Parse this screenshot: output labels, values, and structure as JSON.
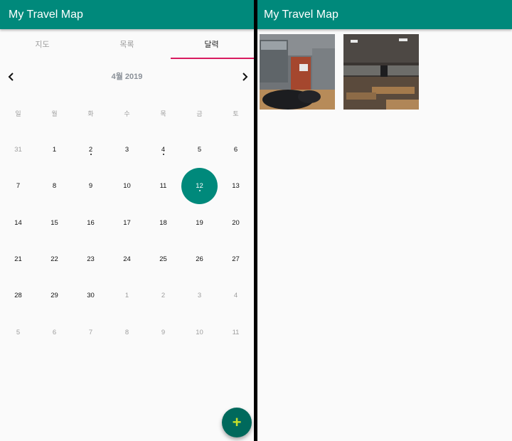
{
  "left_screen": {
    "app_title": "My Travel Map",
    "tabs": [
      {
        "label": "지도",
        "active": false
      },
      {
        "label": "목록",
        "active": false
      },
      {
        "label": "달력",
        "active": true
      }
    ],
    "calendar": {
      "month_label": "4월 2019",
      "weekdays": [
        "일",
        "월",
        "화",
        "수",
        "목",
        "금",
        "토"
      ],
      "selected_day": "12",
      "days": [
        {
          "d": "31",
          "m": true,
          "dot": false
        },
        {
          "d": "1",
          "m": false,
          "dot": false
        },
        {
          "d": "2",
          "m": false,
          "dot": true
        },
        {
          "d": "3",
          "m": false,
          "dot": false
        },
        {
          "d": "4",
          "m": false,
          "dot": true
        },
        {
          "d": "5",
          "m": false,
          "dot": false
        },
        {
          "d": "6",
          "m": false,
          "dot": false
        },
        {
          "d": "7",
          "m": false,
          "dot": false
        },
        {
          "d": "8",
          "m": false,
          "dot": false
        },
        {
          "d": "9",
          "m": false,
          "dot": false
        },
        {
          "d": "10",
          "m": false,
          "dot": false
        },
        {
          "d": "11",
          "m": false,
          "dot": false
        },
        {
          "d": "12",
          "m": false,
          "dot": true,
          "sel": true
        },
        {
          "d": "13",
          "m": false,
          "dot": false
        },
        {
          "d": "14",
          "m": false,
          "dot": false
        },
        {
          "d": "15",
          "m": false,
          "dot": false
        },
        {
          "d": "16",
          "m": false,
          "dot": false
        },
        {
          "d": "17",
          "m": false,
          "dot": false
        },
        {
          "d": "18",
          "m": false,
          "dot": false
        },
        {
          "d": "19",
          "m": false,
          "dot": false
        },
        {
          "d": "20",
          "m": false,
          "dot": false
        },
        {
          "d": "21",
          "m": false,
          "dot": false
        },
        {
          "d": "22",
          "m": false,
          "dot": false
        },
        {
          "d": "23",
          "m": false,
          "dot": false
        },
        {
          "d": "24",
          "m": false,
          "dot": false
        },
        {
          "d": "25",
          "m": false,
          "dot": false
        },
        {
          "d": "26",
          "m": false,
          "dot": false
        },
        {
          "d": "27",
          "m": false,
          "dot": false
        },
        {
          "d": "28",
          "m": false,
          "dot": false
        },
        {
          "d": "29",
          "m": false,
          "dot": false
        },
        {
          "d": "30",
          "m": false,
          "dot": false
        },
        {
          "d": "1",
          "m": true,
          "dot": false
        },
        {
          "d": "2",
          "m": true,
          "dot": false
        },
        {
          "d": "3",
          "m": true,
          "dot": false
        },
        {
          "d": "4",
          "m": true,
          "dot": false
        },
        {
          "d": "5",
          "m": true,
          "dot": false
        },
        {
          "d": "6",
          "m": true,
          "dot": false
        },
        {
          "d": "7",
          "m": true,
          "dot": false
        },
        {
          "d": "8",
          "m": true,
          "dot": false
        },
        {
          "d": "9",
          "m": true,
          "dot": false
        },
        {
          "d": "10",
          "m": true,
          "dot": false
        },
        {
          "d": "11",
          "m": true,
          "dot": false
        }
      ]
    },
    "fab_icon": "plus-icon",
    "prev_icon": "chevron-left-icon",
    "next_icon": "chevron-right-icon"
  },
  "right_screen": {
    "app_title": "My Travel Map",
    "photos": [
      "classroom-door-with-backpack-photo",
      "classroom-desks-photo"
    ]
  },
  "colors": {
    "primary": "#00897b",
    "fab": "#00695c",
    "fab_icon": "#c6e02a",
    "tab_indicator": "#d81b60"
  }
}
